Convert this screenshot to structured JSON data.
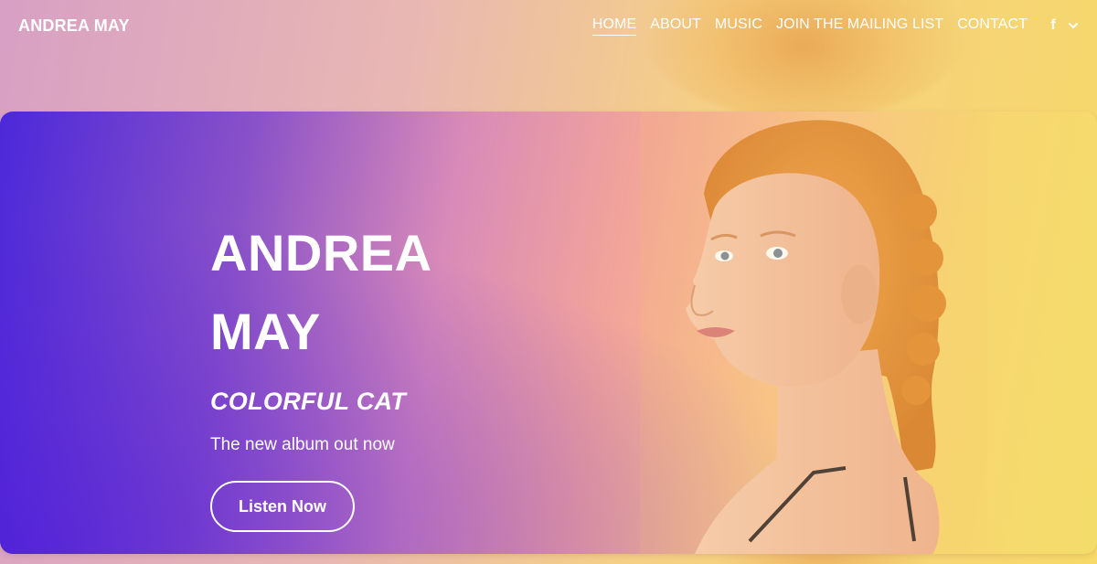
{
  "header": {
    "brand": "ANDREA MAY",
    "nav": [
      {
        "label": "HOME",
        "active": true
      },
      {
        "label": "ABOUT",
        "active": false
      },
      {
        "label": "MUSIC",
        "active": false
      },
      {
        "label": "JOIN THE MAILING LIST",
        "active": false
      },
      {
        "label": "CONTACT",
        "active": false
      }
    ],
    "social": {
      "facebook_glyph": "f",
      "icons": [
        "facebook-icon",
        "chevron-down-icon"
      ]
    }
  },
  "hero": {
    "title_line1": "ANDREA",
    "title_line2": "MAY",
    "subtitle": "COLORFUL CAT",
    "tagline": "The new album out now",
    "cta_label": "Listen Now"
  },
  "colors": {
    "gradient_start": "#4b28d9",
    "gradient_mid": "#f2a49a",
    "gradient_end": "#f4dc6a",
    "text": "#ffffff"
  }
}
